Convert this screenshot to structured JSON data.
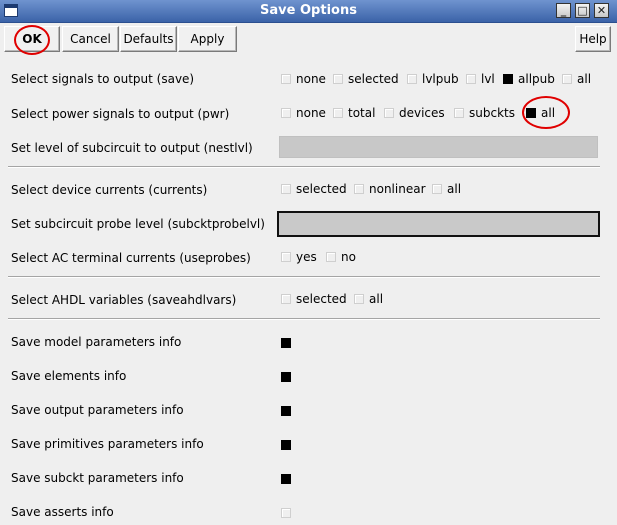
{
  "window": {
    "title": "Save Options",
    "controls": {
      "minimize": "_",
      "maximize": "□",
      "close": "✕"
    }
  },
  "toolbar": {
    "ok_label": "OK",
    "cancel_label": "Cancel",
    "defaults_label": "Defaults",
    "apply_label": "Apply",
    "help_label": "Help"
  },
  "annotation_color": "#e00000",
  "form": {
    "save": {
      "label": "Select signals to output (save)",
      "options": [
        {
          "label": "none",
          "checked": false
        },
        {
          "label": "selected",
          "checked": false
        },
        {
          "label": "lvlpub",
          "checked": false
        },
        {
          "label": "lvl",
          "checked": false
        },
        {
          "label": "allpub",
          "checked": true
        },
        {
          "label": "all",
          "checked": false
        }
      ]
    },
    "pwr": {
      "label": "Select power signals to output (pwr)",
      "options": [
        {
          "label": "none",
          "checked": false
        },
        {
          "label": "total",
          "checked": false
        },
        {
          "label": "devices",
          "checked": false
        },
        {
          "label": "subckts",
          "checked": false
        },
        {
          "label": "all",
          "checked": true
        }
      ]
    },
    "nestlvl": {
      "label": "Set level of subcircuit to output (nestlvl)",
      "value": ""
    },
    "currents": {
      "label": "Select device currents (currents)",
      "options": [
        {
          "label": "selected",
          "checked": false
        },
        {
          "label": "nonlinear",
          "checked": false
        },
        {
          "label": "all",
          "checked": false
        }
      ]
    },
    "subcktprobelvl": {
      "label": "Set subcircuit probe level (subcktprobelvl)",
      "value": ""
    },
    "useprobes": {
      "label": "Select AC terminal currents (useprobes)",
      "options": [
        {
          "label": "yes",
          "checked": false
        },
        {
          "label": "no",
          "checked": false
        }
      ]
    },
    "saveahdlvars": {
      "label": "Select AHDL variables (saveahdlvars)",
      "options": [
        {
          "label": "selected",
          "checked": false
        },
        {
          "label": "all",
          "checked": false
        }
      ]
    },
    "info": [
      {
        "label": "Save model parameters info",
        "checked": true
      },
      {
        "label": "Save elements info",
        "checked": true
      },
      {
        "label": "Save output parameters info",
        "checked": true
      },
      {
        "label": "Save primitives parameters info",
        "checked": true
      },
      {
        "label": "Save subckt parameters info",
        "checked": true
      },
      {
        "label": "Save asserts info",
        "checked": false
      }
    ]
  }
}
